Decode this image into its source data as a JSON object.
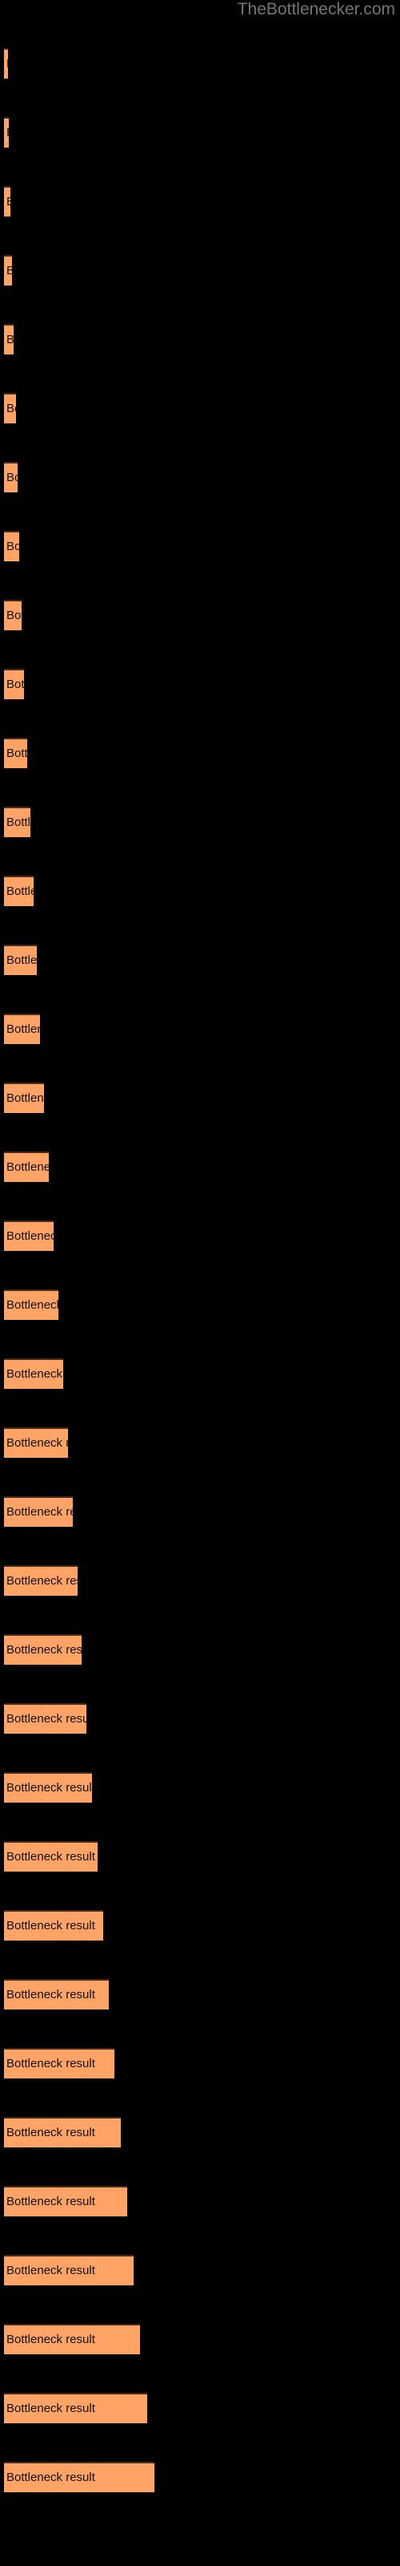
{
  "watermark": {
    "text": "TheBottlenecker.com",
    "color": "#757575"
  },
  "colors": {
    "background": "#000000",
    "bar_fill": "#ffa366",
    "bar_border_top": "#4a2a18",
    "label_text": "#111111",
    "watermark_text": "#757575"
  },
  "chart_data": {
    "type": "bar",
    "orientation": "horizontal",
    "title": "",
    "subtitle": "",
    "xlabel": "",
    "ylabel": "",
    "grid": false,
    "legend": false,
    "axis_visible": false,
    "tick_labels": [],
    "bar_label_text": "Bottleneck result",
    "categories": [
      "Bottleneck result",
      "Bottleneck result",
      "Bottleneck result",
      "Bottleneck result",
      "Bottleneck result",
      "Bottleneck result",
      "Bottleneck result",
      "Bottleneck result",
      "Bottleneck result",
      "Bottleneck result",
      "Bottleneck result",
      "Bottleneck result",
      "Bottleneck result",
      "Bottleneck result",
      "Bottleneck result",
      "Bottleneck result",
      "Bottleneck result",
      "Bottleneck result",
      "Bottleneck result",
      "Bottleneck result",
      "Bottleneck result",
      "Bottleneck result",
      "Bottleneck result",
      "Bottleneck result",
      "Bottleneck result",
      "Bottleneck result",
      "Bottleneck result",
      "Bottleneck result",
      "Bottleneck result",
      "Bottleneck result",
      "Bottleneck result",
      "Bottleneck result",
      "Bottleneck result",
      "Bottleneck result",
      "Bottleneck result",
      "Bottleneck result"
    ],
    "values": [
      5,
      6,
      8,
      10,
      12,
      15,
      17,
      19,
      22,
      25,
      29,
      33,
      37,
      41,
      45,
      50,
      56,
      62,
      68,
      74,
      80,
      86,
      92,
      97,
      103,
      110,
      117,
      124,
      131,
      138,
      146,
      154,
      162,
      170,
      179,
      188
    ],
    "xlim": [
      0,
      200
    ],
    "unit": "px"
  },
  "bars": [
    {
      "label": "Bottleneck result",
      "width": 5,
      "top": 60
    },
    {
      "label": "Bottleneck result",
      "width": 6,
      "top": 146
    },
    {
      "label": "Bottleneck result",
      "width": 8,
      "top": 232
    },
    {
      "label": "Bottleneck result",
      "width": 10,
      "top": 318
    },
    {
      "label": "Bottleneck result",
      "width": 12,
      "top": 404
    },
    {
      "label": "Bottleneck result",
      "width": 15,
      "top": 490
    },
    {
      "label": "Bottleneck result",
      "width": 17,
      "top": 576
    },
    {
      "label": "Bottleneck result",
      "width": 19,
      "top": 662
    },
    {
      "label": "Bottleneck result",
      "width": 22,
      "top": 748
    },
    {
      "label": "Bottleneck result",
      "width": 25,
      "top": 834
    },
    {
      "label": "Bottleneck result",
      "width": 29,
      "top": 920
    },
    {
      "label": "Bottleneck result",
      "width": 33,
      "top": 1006
    },
    {
      "label": "Bottleneck result",
      "width": 37,
      "top": 1092
    },
    {
      "label": "Bottleneck result",
      "width": 41,
      "top": 1178
    },
    {
      "label": "Bottleneck result",
      "width": 45,
      "top": 1264
    },
    {
      "label": "Bottleneck result",
      "width": 50,
      "top": 1350
    },
    {
      "label": "Bottleneck result",
      "width": 56,
      "top": 1436
    },
    {
      "label": "Bottleneck result",
      "width": 62,
      "top": 1522
    },
    {
      "label": "Bottleneck result",
      "width": 68,
      "top": 1608
    },
    {
      "label": "Bottleneck result",
      "width": 74,
      "top": 1694
    },
    {
      "label": "Bottleneck result",
      "width": 80,
      "top": 1780
    },
    {
      "label": "Bottleneck result",
      "width": 86,
      "top": 1866
    },
    {
      "label": "Bottleneck result",
      "width": 92,
      "top": 1952
    },
    {
      "label": "Bottleneck result",
      "width": 97,
      "top": 2038
    },
    {
      "label": "Bottleneck result",
      "width": 103,
      "top": 2124
    },
    {
      "label": "Bottleneck result",
      "width": 110,
      "top": 2210
    },
    {
      "label": "Bottleneck result",
      "width": 117,
      "top": 2296
    },
    {
      "label": "Bottleneck result",
      "width": 124,
      "top": 2382
    },
    {
      "label": "Bottleneck result",
      "width": 131,
      "top": 2468
    },
    {
      "label": "Bottleneck result",
      "width": 138,
      "top": 2554
    },
    {
      "label": "Bottleneck result",
      "width": 146,
      "top": 2640
    },
    {
      "label": "Bottleneck result",
      "width": 154,
      "top": 2726
    },
    {
      "label": "Bottleneck result",
      "width": 162,
      "top": 2812
    },
    {
      "label": "Bottleneck result",
      "width": 170,
      "top": 2898
    },
    {
      "label": "Bottleneck result",
      "width": 179,
      "top": 2984
    },
    {
      "label": "Bottleneck result",
      "width": 188,
      "top": 3070
    }
  ]
}
